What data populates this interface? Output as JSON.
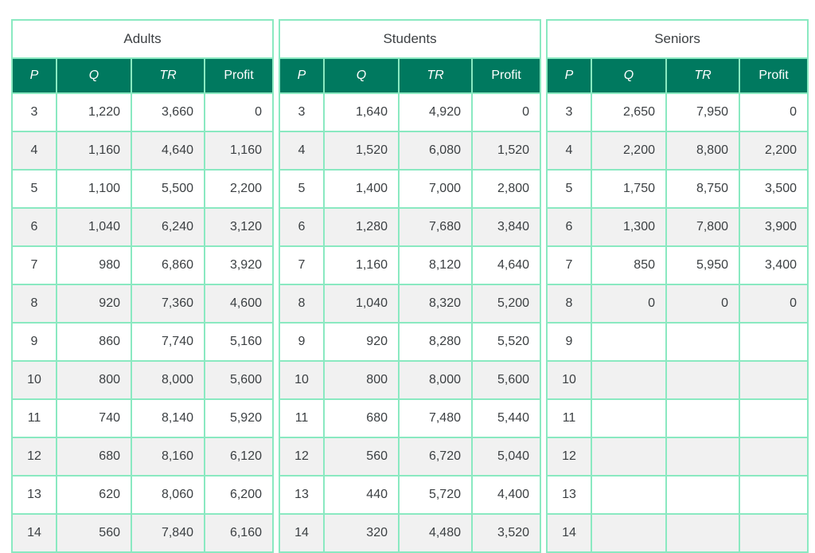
{
  "table": {
    "columns": [
      "P",
      "Q",
      "TR",
      "Profit"
    ],
    "column_italic": [
      true,
      true,
      true,
      false
    ],
    "colors": {
      "header_background": "#00795f",
      "header_text": "#ffffff",
      "gridline": "#8ae9c1",
      "row_stripe": "#f1f1f1",
      "row_base": "#ffffff",
      "body_text": "#3c4043"
    },
    "groups": [
      {
        "title": "Adults",
        "rows": [
          {
            "P": "3",
            "Q": "1,220",
            "TR": "3,660",
            "Profit": "0"
          },
          {
            "P": "4",
            "Q": "1,160",
            "TR": "4,640",
            "Profit": "1,160"
          },
          {
            "P": "5",
            "Q": "1,100",
            "TR": "5,500",
            "Profit": "2,200"
          },
          {
            "P": "6",
            "Q": "1,040",
            "TR": "6,240",
            "Profit": "3,120"
          },
          {
            "P": "7",
            "Q": "980",
            "TR": "6,860",
            "Profit": "3,920"
          },
          {
            "P": "8",
            "Q": "920",
            "TR": "7,360",
            "Profit": "4,600"
          },
          {
            "P": "9",
            "Q": "860",
            "TR": "7,740",
            "Profit": "5,160"
          },
          {
            "P": "10",
            "Q": "800",
            "TR": "8,000",
            "Profit": "5,600"
          },
          {
            "P": "11",
            "Q": "740",
            "TR": "8,140",
            "Profit": "5,920"
          },
          {
            "P": "12",
            "Q": "680",
            "TR": "8,160",
            "Profit": "6,120"
          },
          {
            "P": "13",
            "Q": "620",
            "TR": "8,060",
            "Profit": "6,200"
          },
          {
            "P": "14",
            "Q": "560",
            "TR": "7,840",
            "Profit": "6,160"
          }
        ]
      },
      {
        "title": "Students",
        "rows": [
          {
            "P": "3",
            "Q": "1,640",
            "TR": "4,920",
            "Profit": "0"
          },
          {
            "P": "4",
            "Q": "1,520",
            "TR": "6,080",
            "Profit": "1,520"
          },
          {
            "P": "5",
            "Q": "1,400",
            "TR": "7,000",
            "Profit": "2,800"
          },
          {
            "P": "6",
            "Q": "1,280",
            "TR": "7,680",
            "Profit": "3,840"
          },
          {
            "P": "7",
            "Q": "1,160",
            "TR": "8,120",
            "Profit": "4,640"
          },
          {
            "P": "8",
            "Q": "1,040",
            "TR": "8,320",
            "Profit": "5,200"
          },
          {
            "P": "9",
            "Q": "920",
            "TR": "8,280",
            "Profit": "5,520"
          },
          {
            "P": "10",
            "Q": "800",
            "TR": "8,000",
            "Profit": "5,600"
          },
          {
            "P": "11",
            "Q": "680",
            "TR": "7,480",
            "Profit": "5,440"
          },
          {
            "P": "12",
            "Q": "560",
            "TR": "6,720",
            "Profit": "5,040"
          },
          {
            "P": "13",
            "Q": "440",
            "TR": "5,720",
            "Profit": "4,400"
          },
          {
            "P": "14",
            "Q": "320",
            "TR": "4,480",
            "Profit": "3,520"
          }
        ]
      },
      {
        "title": "Seniors",
        "rows": [
          {
            "P": "3",
            "Q": "2,650",
            "TR": "7,950",
            "Profit": "0"
          },
          {
            "P": "4",
            "Q": "2,200",
            "TR": "8,800",
            "Profit": "2,200"
          },
          {
            "P": "5",
            "Q": "1,750",
            "TR": "8,750",
            "Profit": "3,500"
          },
          {
            "P": "6",
            "Q": "1,300",
            "TR": "7,800",
            "Profit": "3,900"
          },
          {
            "P": "7",
            "Q": "850",
            "TR": "5,950",
            "Profit": "3,400"
          },
          {
            "P": "8",
            "Q": "0",
            "TR": "0",
            "Profit": "0"
          },
          {
            "P": "9",
            "Q": "",
            "TR": "",
            "Profit": ""
          },
          {
            "P": "10",
            "Q": "",
            "TR": "",
            "Profit": ""
          },
          {
            "P": "11",
            "Q": "",
            "TR": "",
            "Profit": ""
          },
          {
            "P": "12",
            "Q": "",
            "TR": "",
            "Profit": ""
          },
          {
            "P": "13",
            "Q": "",
            "TR": "",
            "Profit": ""
          },
          {
            "P": "14",
            "Q": "",
            "TR": "",
            "Profit": ""
          }
        ]
      }
    ]
  }
}
